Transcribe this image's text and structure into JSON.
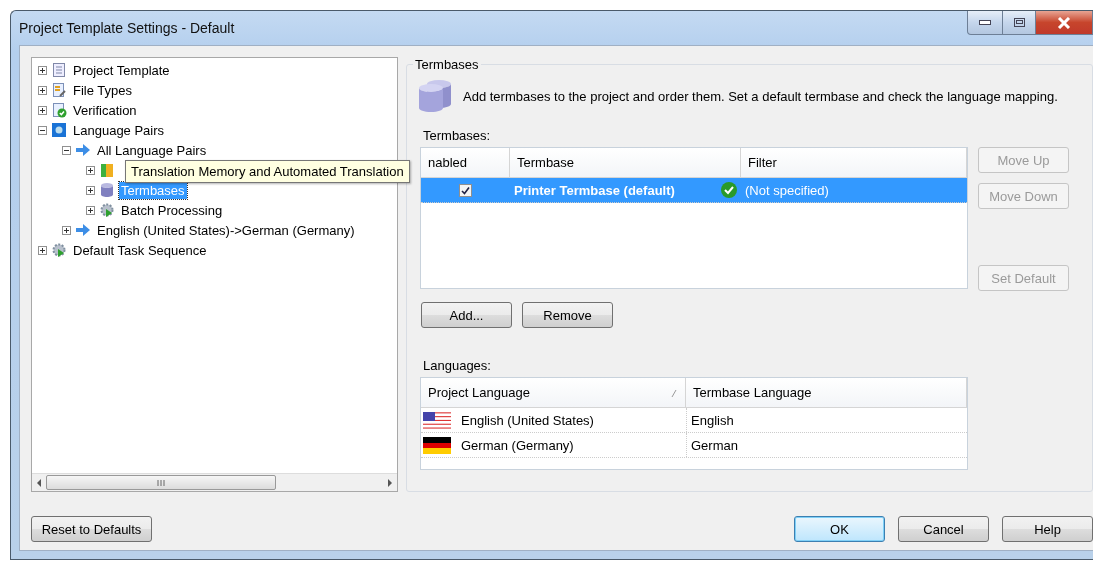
{
  "window": {
    "title": "Project Template Settings - Default"
  },
  "tree": [
    {
      "label": "Project Template",
      "kind": "document",
      "expanded": false,
      "selected": false
    },
    {
      "label": "File Types",
      "kind": "filetypes",
      "expanded": false,
      "selected": false
    },
    {
      "label": "Verification",
      "kind": "verification",
      "expanded": false,
      "selected": false
    },
    {
      "label": "Language Pairs",
      "kind": "languages",
      "expanded": true,
      "selected": false,
      "children": [
        {
          "label": "All Language Pairs",
          "kind": "arrow",
          "expanded": true,
          "selected": false,
          "children": [
            {
              "kind": "memory",
              "expanded": false,
              "selected": false
            },
            {
              "label": "Termbases",
              "kind": "termbase",
              "expanded": false,
              "selected": true
            },
            {
              "label": "Batch Processing",
              "kind": "gear",
              "expanded": false,
              "selected": false
            }
          ]
        },
        {
          "label": "English (United States)->German (Germany)",
          "kind": "arrow",
          "expanded": false,
          "selected": false
        }
      ]
    },
    {
      "label": "Default Task Sequence",
      "kind": "gear",
      "expanded": false,
      "selected": false
    }
  ],
  "tooltip": {
    "text": "Translation Memory and Automated Translation"
  },
  "group": {
    "title": "Termbases",
    "description": "Add termbases to the project and order them. Set a default termbase and check the language mapping.",
    "list_label": "Termbases:",
    "columns": [
      "nabled",
      "Termbase",
      "Filter"
    ],
    "rows": [
      {
        "enabled": true,
        "name": "Printer Termbase (default)",
        "valid": true,
        "filter": "(Not specified)",
        "selected": true
      }
    ],
    "side_buttons": [
      {
        "label": "Move Up",
        "disabled": true
      },
      {
        "label": "Move Down",
        "disabled": true
      },
      {
        "label": "Set Default",
        "disabled": true
      }
    ],
    "buttons": [
      {
        "label": "Add...",
        "disabled": false
      },
      {
        "label": "Remove",
        "disabled": false
      }
    ],
    "languages_label": "Languages:",
    "language_columns": [
      {
        "label": "Project Language",
        "sorted": true
      },
      {
        "label": "Termbase Language",
        "sorted": false
      }
    ],
    "languages": [
      {
        "kind": "us",
        "project_language": "English (United States)",
        "termbase_language": "English"
      },
      {
        "kind": "de",
        "project_language": "German (Germany)",
        "termbase_language": "German"
      }
    ]
  },
  "reset_button": "Reset to Defaults",
  "dialog_buttons": [
    {
      "label": "OK",
      "default": true
    },
    {
      "label": "Cancel",
      "default": false
    },
    {
      "label": "Help",
      "default": false
    }
  ]
}
